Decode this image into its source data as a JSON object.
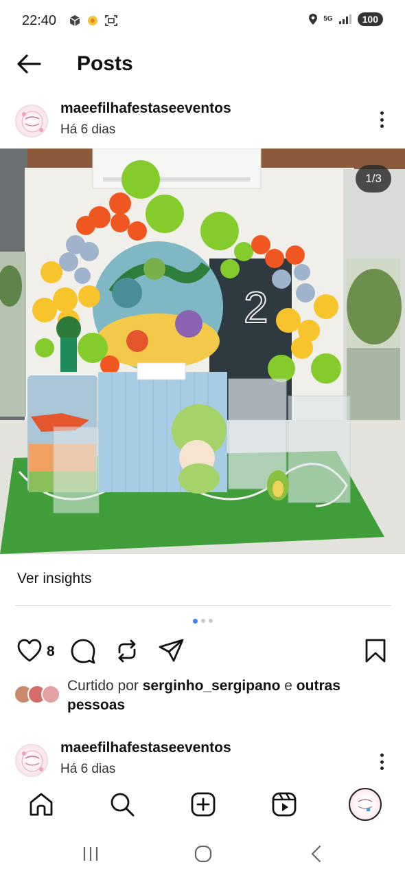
{
  "status": {
    "time": "22:40",
    "battery": "100",
    "network": "5G"
  },
  "header": {
    "title": "Posts"
  },
  "post": {
    "username": "maeefilhafestaseeventos",
    "date": "Há 6 dias",
    "image_counter": "1/3",
    "image_content": {
      "number_sign": "2"
    },
    "insights_label": "Ver insights",
    "like_count": "8",
    "liked_by_prefix": "Curtido por ",
    "liked_by_user": "serginho_sergipano",
    "liked_by_middle": " e ",
    "liked_by_others": "outras pessoas"
  },
  "next_post": {
    "username": "maeefilhafestaseeventos",
    "date": "Há 6 dias"
  },
  "colors": {
    "accent_blue": "#3b82f6",
    "divider": "#dbdbdb"
  }
}
